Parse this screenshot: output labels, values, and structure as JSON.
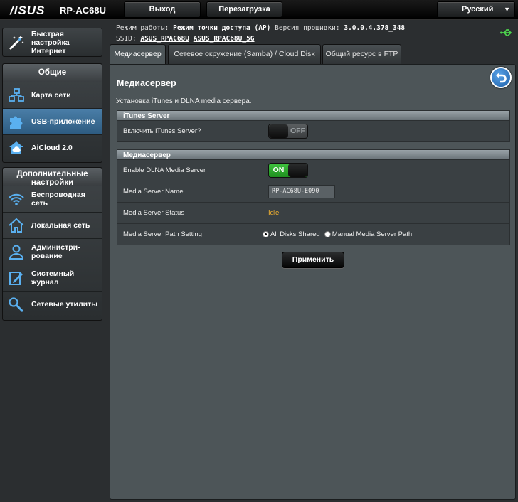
{
  "header": {
    "logo": "/ISUS",
    "model": "RP-AC68U",
    "logout_label": "Выход",
    "reboot_label": "Перезагрузка",
    "language": "Русский"
  },
  "info": {
    "mode_label": "Режим работы:",
    "mode_value": "Режим точки доступа (AP)",
    "firmware_label": "Версия прошивки:",
    "firmware_value": "3.0.0.4.378_348",
    "ssid_label": "SSID:",
    "ssid_1": "ASUS_RPAC68U",
    "ssid_2": "ASUS_RPAC68U_5G"
  },
  "sidebar": {
    "quick_setup": "Быстрая настройка Интернет",
    "general_header": "Общие",
    "general_items": [
      {
        "label": "Карта сети",
        "icon": "network-map-icon"
      },
      {
        "label": "USB-приложение",
        "icon": "puzzle-icon"
      },
      {
        "label": "AiCloud 2.0",
        "icon": "cloud-icon"
      }
    ],
    "advanced_header": "Дополнительные настройки",
    "advanced_items": [
      {
        "label": "Беспроводная сеть",
        "icon": "wifi-icon"
      },
      {
        "label": "Локальная сеть",
        "icon": "home-icon"
      },
      {
        "label": "Администри-рование",
        "icon": "user-icon"
      },
      {
        "label": "Системный журнал",
        "icon": "log-icon"
      },
      {
        "label": "Сетевые утилиты",
        "icon": "tools-icon"
      }
    ]
  },
  "tabs": [
    "Медиасервер",
    "Сетевое окружение (Samba) / Cloud Disk",
    "Общий ресурс в FTP"
  ],
  "panel": {
    "title": "Медиасервер",
    "description": "Установка iTunes и DLNA media сервера.",
    "itunes_header": "iTunes Server",
    "itunes_enable_label": "Включить iTunes Server?",
    "itunes_state": "OFF",
    "media_header": "Медиасервер",
    "dlna_label": "Enable DLNA Media Server",
    "dlna_state": "ON",
    "name_label": "Media Server Name",
    "name_value": "RP-AC68U-E090",
    "status_label": "Media Server Status",
    "status_value": "Idle",
    "path_label": "Media Server Path Setting",
    "path_option_all": "All Disks Shared",
    "path_option_manual": "Manual Media Server Path",
    "apply_label": "Применить"
  },
  "colors": {
    "accent_active": "#3a6d96",
    "toggle_on": "#2fa82f",
    "status_idle": "#f0b030"
  }
}
